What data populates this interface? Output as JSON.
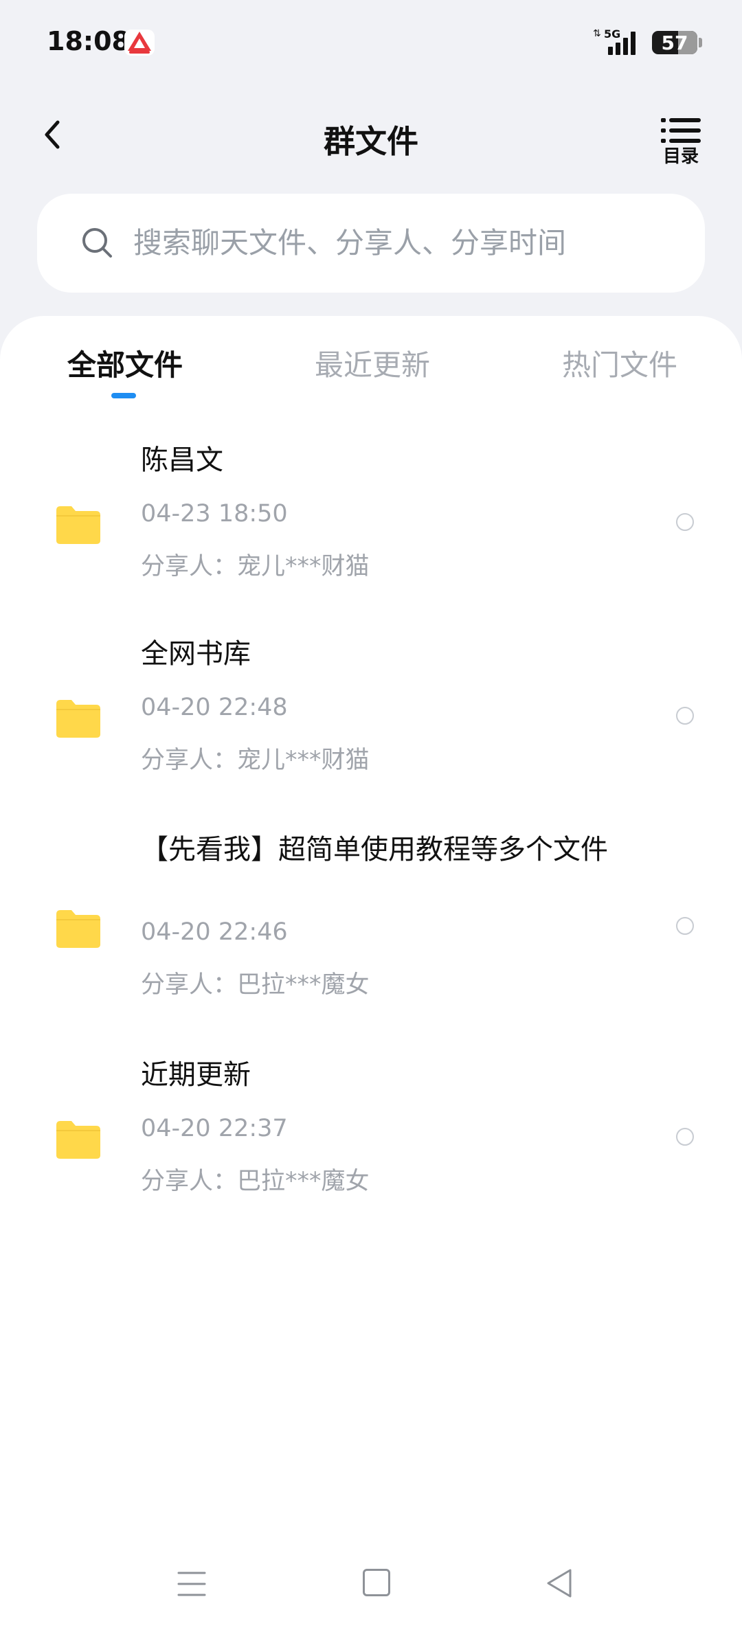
{
  "status_bar": {
    "time": "18:08",
    "network": "5G",
    "battery": "57",
    "battery_level": 0.57
  },
  "header": {
    "title": "群文件",
    "catalog_label": "目录"
  },
  "search": {
    "placeholder": "搜索聊天文件、分享人、分享时间"
  },
  "tabs": [
    {
      "label": "全部文件",
      "active": true
    },
    {
      "label": "最近更新",
      "active": false
    },
    {
      "label": "热门文件",
      "active": false
    }
  ],
  "files": [
    {
      "name": "陈昌文",
      "time": "04-23  18:50",
      "sharer": "分享人：宠儿***财猫"
    },
    {
      "name": "全网书库",
      "time": "04-20  22:48",
      "sharer": "分享人：宠儿***财猫"
    },
    {
      "name": "【先看我】超简单使用教程等多个文件",
      "time": "04-20  22:46",
      "sharer": "分享人：巴拉***魔女"
    },
    {
      "name": "近期更新",
      "time": "04-20  22:37",
      "sharer": "分享人：巴拉***魔女"
    }
  ],
  "colors": {
    "accent": "#1e8df2",
    "folder": "#ffd84a",
    "background": "#f1f2f6"
  }
}
